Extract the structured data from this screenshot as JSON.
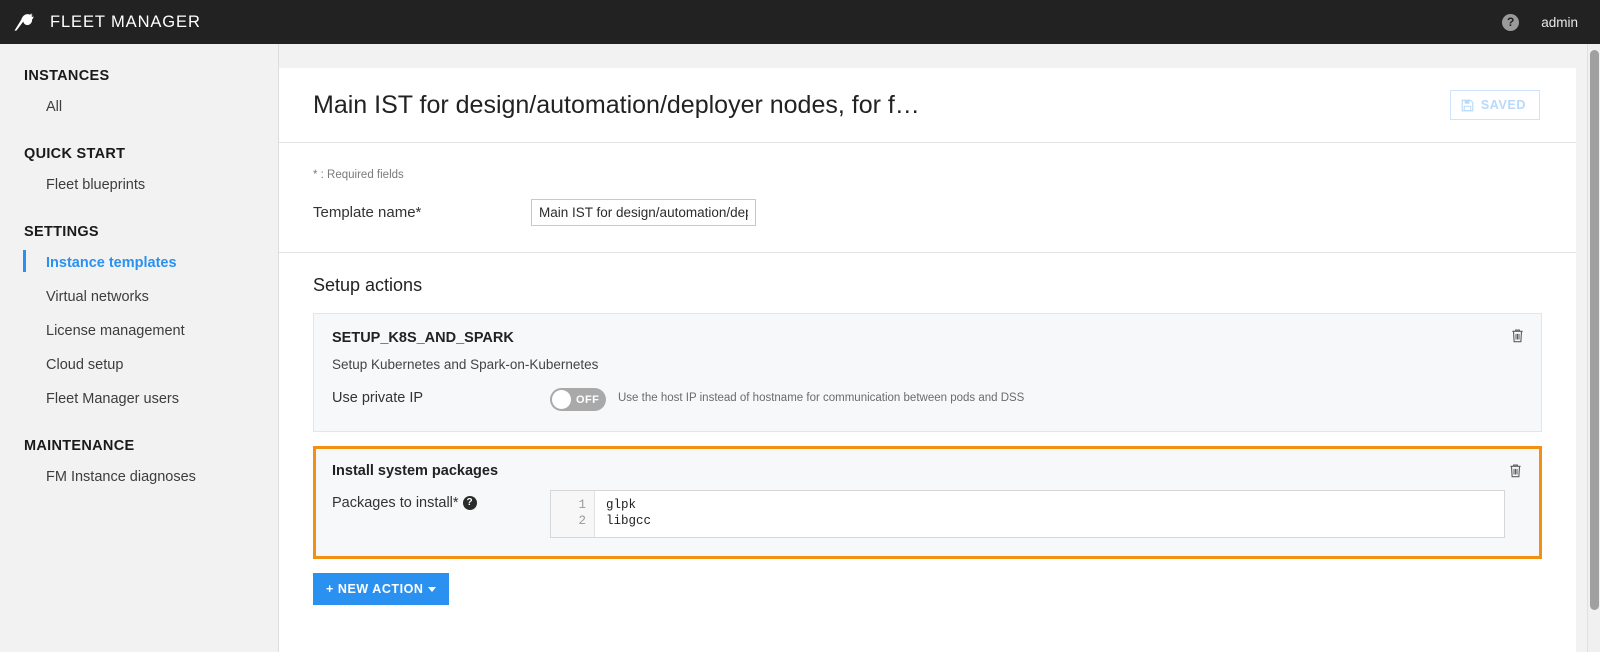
{
  "topbar": {
    "app_title": "FLEET MANAGER",
    "logo_icon": "dataiku-bird-icon",
    "help_icon": "question-mark-circle-icon",
    "help_label": "?",
    "user_name": "admin"
  },
  "sidebar": {
    "sections": [
      {
        "title": "INSTANCES",
        "items": [
          {
            "label": "All",
            "active": false
          }
        ]
      },
      {
        "title": "QUICK START",
        "items": [
          {
            "label": "Fleet blueprints",
            "active": false
          }
        ]
      },
      {
        "title": "SETTINGS",
        "items": [
          {
            "label": "Instance templates",
            "active": true
          },
          {
            "label": "Virtual networks",
            "active": false
          },
          {
            "label": "License management",
            "active": false
          },
          {
            "label": "Cloud setup",
            "active": false
          },
          {
            "label": "Fleet Manager users",
            "active": false
          }
        ]
      },
      {
        "title": "MAINTENANCE",
        "items": [
          {
            "label": "FM Instance diagnoses",
            "active": false
          }
        ]
      }
    ]
  },
  "main": {
    "page_title": "Main IST for design/automation/deployer nodes, for f…",
    "save_button": {
      "label": "SAVED",
      "icon": "floppy-disk-save-icon",
      "state": "disabled"
    },
    "form": {
      "required_note": "* : Required fields",
      "template_name_label": "Template name*",
      "template_name_value": "Main IST for design/automation/dep",
      "template_name_placeholder": "Template name"
    },
    "setup_actions": {
      "section_title": "Setup actions",
      "actions": [
        {
          "name": "SETUP_K8S_AND_SPARK",
          "description": "Setup Kubernetes and Spark-on-Kubernetes",
          "highlighted": false,
          "delete_icon": "trash-icon",
          "field": {
            "type": "toggle",
            "label": "Use private IP",
            "toggle_state": "OFF",
            "hint": "Use the host IP instead of hostname for communication between pods and DSS"
          }
        },
        {
          "name": "Install system packages",
          "description": "",
          "highlighted": true,
          "delete_icon": "trash-icon",
          "field": {
            "type": "code",
            "label": "Packages to install*",
            "help_icon": "question-mark-circle-icon",
            "help_label": "?",
            "lines": [
              "glpk",
              "libgcc"
            ],
            "line_numbers": [
              "1",
              "2"
            ]
          }
        }
      ],
      "new_action_button": "+ NEW ACTION"
    }
  },
  "colors": {
    "accent_blue": "#2a91f0",
    "highlight_orange": "#f29111",
    "topbar_dark": "#222222",
    "page_bg": "#f2f2f2",
    "card_bg": "#f7f8f9"
  }
}
